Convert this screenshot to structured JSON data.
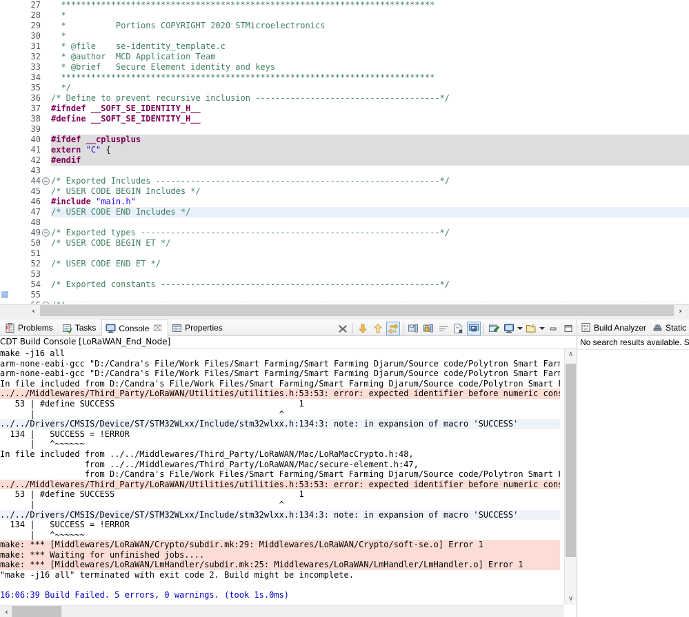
{
  "editor": {
    "first_line_number": 27,
    "lines": [
      {
        "n": 27,
        "fold": false,
        "hl": "none",
        "spans": [
          {
            "t": "  ***************************************************************************",
            "c": "comment"
          }
        ]
      },
      {
        "n": 28,
        "fold": false,
        "hl": "none",
        "spans": [
          {
            "t": "  *",
            "c": "comment"
          }
        ]
      },
      {
        "n": 29,
        "fold": false,
        "hl": "none",
        "spans": [
          {
            "t": "  *          Portions COPYRIGHT 2020 STMicroelectronics",
            "c": "comment"
          }
        ]
      },
      {
        "n": 30,
        "fold": false,
        "hl": "none",
        "spans": [
          {
            "t": "  *",
            "c": "comment"
          }
        ]
      },
      {
        "n": 31,
        "fold": false,
        "hl": "none",
        "spans": [
          {
            "t": "  * @file    se-identity_template.c",
            "c": "comment"
          }
        ]
      },
      {
        "n": 32,
        "fold": false,
        "hl": "none",
        "spans": [
          {
            "t": "  * @author  MCD Application Team",
            "c": "comment"
          }
        ]
      },
      {
        "n": 33,
        "fold": false,
        "hl": "none",
        "spans": [
          {
            "t": "  * @brief   Secure Element identity and keys",
            "c": "comment"
          }
        ]
      },
      {
        "n": 34,
        "fold": false,
        "hl": "none",
        "spans": [
          {
            "t": "  ***************************************************************************",
            "c": "comment"
          }
        ]
      },
      {
        "n": 35,
        "fold": false,
        "hl": "none",
        "spans": [
          {
            "t": "  */",
            "c": "comment"
          }
        ]
      },
      {
        "n": 36,
        "fold": false,
        "hl": "none",
        "spans": [
          {
            "t": "/* Define to prevent recursive inclusion -------------------------------------*/",
            "c": "comment"
          }
        ]
      },
      {
        "n": 37,
        "fold": false,
        "hl": "none",
        "spans": [
          {
            "t": "#ifndef __SOFT_SE_IDENTITY_H__",
            "c": "pp"
          }
        ]
      },
      {
        "n": 38,
        "fold": false,
        "hl": "none",
        "spans": [
          {
            "t": "#define __SOFT_SE_IDENTITY_H__",
            "c": "pp"
          }
        ]
      },
      {
        "n": 39,
        "fold": false,
        "hl": "none",
        "spans": [
          {
            "t": "",
            "c": "plain"
          }
        ]
      },
      {
        "n": 40,
        "fold": false,
        "hl": "gray",
        "spans": [
          {
            "t": "#ifdef __cplusplus",
            "c": "pp"
          }
        ]
      },
      {
        "n": 41,
        "fold": false,
        "hl": "gray",
        "spans": [
          {
            "t": "extern ",
            "c": "kw"
          },
          {
            "t": "\"C\"",
            "c": "str"
          },
          {
            "t": " {",
            "c": "plain"
          }
        ]
      },
      {
        "n": 42,
        "fold": false,
        "hl": "gray",
        "spans": [
          {
            "t": "#endif",
            "c": "pp"
          }
        ]
      },
      {
        "n": 43,
        "fold": false,
        "hl": "none",
        "spans": [
          {
            "t": "",
            "c": "plain"
          }
        ]
      },
      {
        "n": 44,
        "fold": true,
        "hl": "none",
        "spans": [
          {
            "t": "/* Exported Includes ---------------------------------------------------------*/",
            "c": "comment"
          }
        ]
      },
      {
        "n": 45,
        "fold": false,
        "hl": "none",
        "spans": [
          {
            "t": "/* USER CODE BEGIN Includes */",
            "c": "comment"
          }
        ]
      },
      {
        "n": 46,
        "fold": false,
        "hl": "none",
        "spans": [
          {
            "t": "#include ",
            "c": "pp"
          },
          {
            "t": "\"main.h\"",
            "c": "str"
          }
        ]
      },
      {
        "n": 47,
        "fold": false,
        "hl": "blue",
        "spans": [
          {
            "t": "/* USER CODE END Includes */",
            "c": "comment"
          }
        ]
      },
      {
        "n": 48,
        "fold": false,
        "hl": "none",
        "spans": [
          {
            "t": "",
            "c": "plain"
          }
        ]
      },
      {
        "n": 49,
        "fold": true,
        "hl": "none",
        "spans": [
          {
            "t": "/* Exported types ------------------------------------------------------------*/",
            "c": "comment"
          }
        ]
      },
      {
        "n": 50,
        "fold": false,
        "hl": "none",
        "spans": [
          {
            "t": "/* USER CODE BEGIN ET */",
            "c": "comment"
          }
        ]
      },
      {
        "n": 51,
        "fold": false,
        "hl": "none",
        "spans": [
          {
            "t": "",
            "c": "plain"
          }
        ]
      },
      {
        "n": 52,
        "fold": false,
        "hl": "none",
        "spans": [
          {
            "t": "/* USER CODE END ET */",
            "c": "comment"
          }
        ]
      },
      {
        "n": 53,
        "fold": false,
        "hl": "none",
        "spans": [
          {
            "t": "",
            "c": "plain"
          }
        ]
      },
      {
        "n": 54,
        "fold": false,
        "hl": "none",
        "spans": [
          {
            "t": "/* Exported constants --------------------------------------------------------*/",
            "c": "comment"
          }
        ]
      },
      {
        "n": 55,
        "fold": false,
        "hl": "none",
        "marker": true,
        "spans": [
          {
            "t": "",
            "c": "plain"
          }
        ]
      },
      {
        "n": 56,
        "fold": true,
        "hl": "none",
        "spans": [
          {
            "t": "/*!",
            "c": "comment"
          }
        ]
      }
    ],
    "hscroll": {
      "left_arrow": "‹",
      "right_arrow": "›"
    }
  },
  "bottom_panel": {
    "tabs": [
      {
        "label": "Problems",
        "icon": "problems-icon",
        "active": false,
        "closable": false
      },
      {
        "label": "Tasks",
        "icon": "tasks-icon",
        "active": false,
        "closable": false
      },
      {
        "label": "Console",
        "icon": "console-icon",
        "active": true,
        "closable": true,
        "close_glyph": "⌧"
      },
      {
        "label": "Properties",
        "icon": "properties-icon",
        "active": false,
        "closable": false
      }
    ],
    "toolbar": [
      {
        "name": "terminate-button",
        "icon": "x-bold-icon",
        "toggled": false
      },
      {
        "name": "separator-1",
        "icon": "separator",
        "toggled": false
      },
      {
        "name": "scroll-down-button",
        "icon": "arrow-down-icon",
        "toggled": false
      },
      {
        "name": "scroll-up-button",
        "icon": "arrow-up-icon",
        "toggled": false
      },
      {
        "name": "scroll-lock-button",
        "icon": "scroll-lock-icon",
        "toggled": true
      },
      {
        "name": "separator-2",
        "icon": "separator",
        "toggled": false
      },
      {
        "name": "save-console-button",
        "icon": "save-console-icon",
        "toggled": false
      },
      {
        "name": "pin-console-button",
        "icon": "lock-console-icon",
        "toggled": false
      },
      {
        "name": "word-wrap-button",
        "icon": "wrap-lines-icon",
        "toggled": false
      },
      {
        "name": "clear-console-button",
        "icon": "clear-console-icon",
        "toggled": false
      },
      {
        "name": "show-console-button",
        "icon": "show-console-icon",
        "toggled": true
      },
      {
        "name": "separator-3",
        "icon": "separator",
        "toggled": false
      },
      {
        "name": "pin-button",
        "icon": "pin-icon",
        "toggled": false
      },
      {
        "name": "display-selected-console-button",
        "icon": "display-console-icon",
        "toggled": false,
        "dropdown": true
      },
      {
        "name": "open-console-button",
        "icon": "new-console-icon",
        "toggled": false,
        "dropdown": true
      },
      {
        "name": "minimize-button",
        "icon": "minimize-icon",
        "toggled": false
      },
      {
        "name": "maximize-button",
        "icon": "maximize-icon",
        "toggled": false
      }
    ],
    "console_title": "CDT Build Console [LoRaWAN_End_Node]",
    "console_lines": [
      {
        "text": "make -j16 all",
        "style": "normal"
      },
      {
        "text": "arm-none-eabi-gcc \"D:/Candra's File/Work Files/Smart Farming/Smart Farming Djarum/Source code/Polytron Smart Farming Dja",
        "style": "normal"
      },
      {
        "text": "arm-none-eabi-gcc \"D:/Candra's File/Work Files/Smart Farming/Smart Farming Djarum/Source code/Polytron Smart Farming Dja",
        "style": "normal"
      },
      {
        "text": "In file included from D:/Candra's File/Work Files/Smart Farming/Smart Farming Djarum/Source code/Polytron Smart Farming",
        "style": "normal"
      },
      {
        "text": "../../Middlewares/Third_Party/LoRaWAN/Utilities/utilities.h:53:53: error: expected identifier before numeric constant",
        "style": "error"
      },
      {
        "text": "   53 | #define SUCCESS                                     1",
        "style": "normal"
      },
      {
        "text": "      |                                                 ^",
        "style": "normal"
      },
      {
        "text": "../../Drivers/CMSIS/Device/ST/STM32WLxx/Include/stm32wlxx.h:134:3: note: in expansion of macro 'SUCCESS'",
        "style": "note"
      },
      {
        "text": "  134 |   SUCCESS = !ERROR",
        "style": "normal"
      },
      {
        "text": "      |   ^~~~~~~",
        "style": "normal"
      },
      {
        "text": "In file included from ../../Middlewares/Third_Party/LoRaWAN/Mac/LoRaMacCrypto.h:48,",
        "style": "normal"
      },
      {
        "text": "                 from ../../Middlewares/Third_Party/LoRaWAN/Mac/secure-element.h:47,",
        "style": "normal"
      },
      {
        "text": "                 from D:/Candra's File/Work Files/Smart Farming/Smart Farming Djarum/Source code/Polytron Smart Farming",
        "style": "normal"
      },
      {
        "text": "../../Middlewares/Third_Party/LoRaWAN/Utilities/utilities.h:53:53: error: expected identifier before numeric constant",
        "style": "error"
      },
      {
        "text": "   53 | #define SUCCESS                                     1",
        "style": "normal"
      },
      {
        "text": "      |                                                 ^",
        "style": "normal"
      },
      {
        "text": "../../Drivers/CMSIS/Device/ST/STM32WLxx/Include/stm32wlxx.h:134:3: note: in expansion of macro 'SUCCESS'",
        "style": "note"
      },
      {
        "text": "  134 |   SUCCESS = !ERROR",
        "style": "normal"
      },
      {
        "text": "      |   ^~~~~~~",
        "style": "normal"
      },
      {
        "text": "make: *** [Middlewares/LoRaWAN/Crypto/subdir.mk:29: Middlewares/LoRaWAN/Crypto/soft-se.o] Error 1",
        "style": "error"
      },
      {
        "text": "make: *** Waiting for unfinished jobs....",
        "style": "error"
      },
      {
        "text": "make: *** [Middlewares/LoRaWAN/LmHandler/subdir.mk:25: Middlewares/LoRaWAN/LmHandler/LmHandler.o] Error 1",
        "style": "error"
      },
      {
        "text": "\"make -j16 all\" terminated with exit code 2. Build might be incomplete.",
        "style": "normal"
      },
      {
        "text": "",
        "style": "normal"
      },
      {
        "text": "16:06:39 Build Failed. 5 errors, 0 warnings. (took 1s.0ms)",
        "style": "blue"
      }
    ],
    "vscroll": {
      "up_arrow": "∧",
      "down_arrow": "∨"
    },
    "hscroll": {
      "left_arrow": "‹"
    }
  },
  "right_panel": {
    "tabs": [
      {
        "label": "Build Analyzer",
        "icon": "build-analyzer-icon",
        "active": false
      },
      {
        "label": "Static S",
        "icon": "static-stack-icon",
        "active": false
      }
    ],
    "message": "No search results available. Sta"
  },
  "colors": {
    "comment_green": "#3f7f5f",
    "preprocessor_purple": "#7f0055",
    "string_blue": "#2a00ff",
    "error_row_bg": "#fbddd5",
    "note_row_bg": "#eef2fa",
    "inactive_code_bg": "#dddddd",
    "selected_line_bg": "#e8f1fb",
    "build_failed_text": "#0000cc",
    "toggle_active_bg": "#dcecfb"
  }
}
